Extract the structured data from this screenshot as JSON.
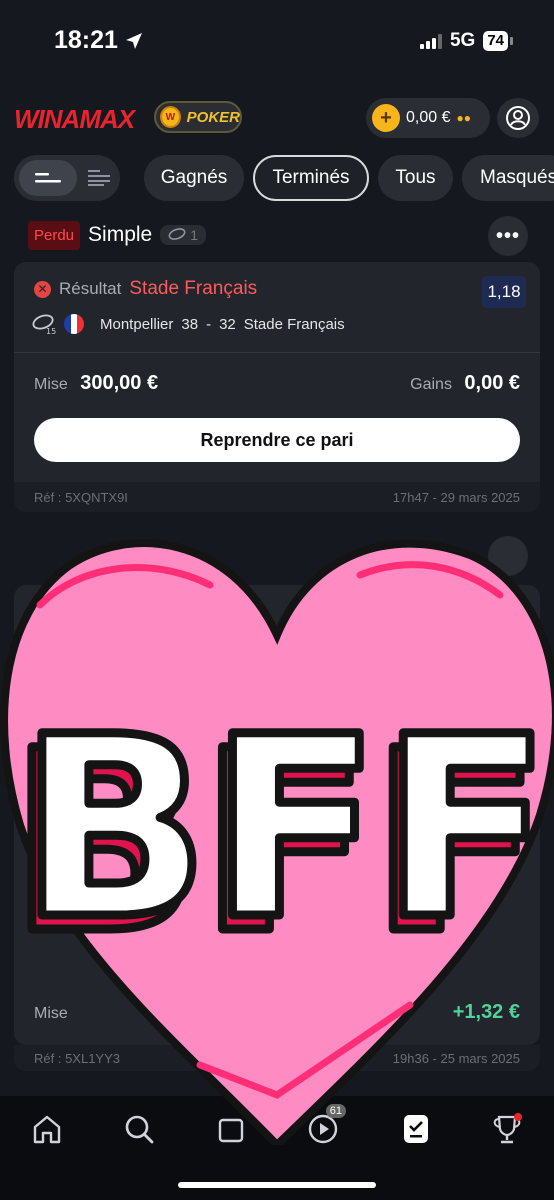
{
  "status": {
    "time": "18:21",
    "network": "5G",
    "battery": "74"
  },
  "header": {
    "logo": "WINAMAX",
    "poker_label": "POKER",
    "balance": "0,00 €"
  },
  "filters": [
    "Gagnés",
    "Terminés",
    "Tous",
    "Masqués"
  ],
  "active_filter": "Terminés",
  "bet1": {
    "status": "Perdu",
    "type": "Simple",
    "selection_count": "1",
    "result_label": "Résultat",
    "result_team": "Stade Français",
    "odds": "1,18",
    "match_home": "Montpellier",
    "score_home": "38",
    "score_sep": "-",
    "score_away": "32",
    "match_away": "Stade Français",
    "stake_label": "Mise",
    "stake": "300,00 €",
    "gains_label": "Gains",
    "gains": "0,00 €",
    "replay_button": "Reprendre ce pari",
    "ref": "Réf : 5XQNTX9I",
    "date": "17h47 - 29 mars 2025"
  },
  "bet2": {
    "stake_label": "Mise",
    "gains": "+1,32 €",
    "ref": "Réf : 5XL1YY3",
    "date": "19h36 - 25 mars 2025"
  },
  "sticker": {
    "text": "BFF"
  },
  "nav": {
    "live_badge": "61"
  },
  "colors": {
    "accent_red": "#e8242e",
    "lost_red": "#ff5a5a",
    "win_green": "#4fd39a",
    "heart_pink": "#ff8bc3"
  }
}
